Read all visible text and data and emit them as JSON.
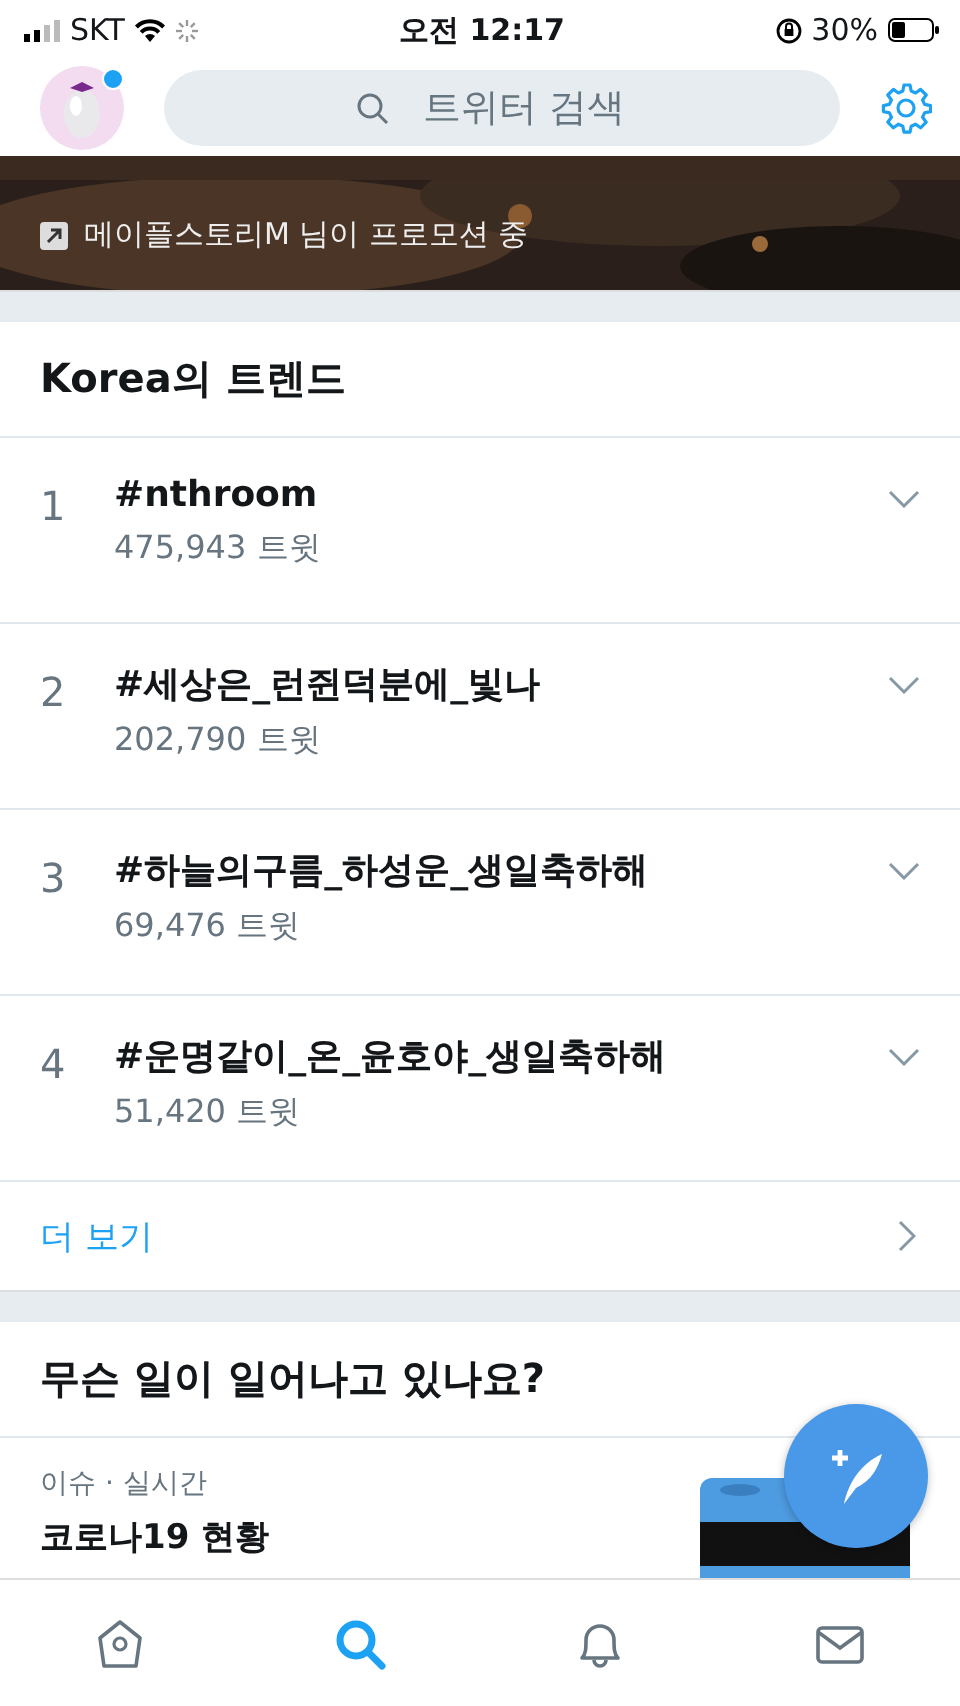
{
  "status_bar": {
    "carrier": "SKT",
    "time": "오전 12:17",
    "battery": "30%"
  },
  "header": {
    "search": {
      "placeholder": "트위터 검색"
    },
    "avatar_has_notification": true
  },
  "promo": {
    "kind": "picture",
    "sponsor": "메이플스토리M 님이 프로모션 중"
  },
  "trends": {
    "title": "Korea의 트렌드",
    "items": [
      {
        "rank": "1",
        "tag": "#nthroom",
        "count": "475,943 트윗"
      },
      {
        "rank": "2",
        "tag": "#세상은_런쥔덕분에_빛나",
        "count": "202,790 트윗"
      },
      {
        "rank": "3",
        "tag": "#하늘의구름_하성운_생일축하해",
        "count": "69,476 트윗"
      },
      {
        "rank": "4",
        "tag": "#운명같이_온_윤호야_생일축하해",
        "count": "51,420 트윗"
      }
    ],
    "more": "더 보기"
  },
  "happening": {
    "title": "무슨 일이 일어나고 있나요?",
    "items": [
      {
        "meta": "이슈 · 실시간",
        "headline": "코로나19 현황"
      }
    ]
  },
  "tab_bar": [
    {
      "kind": "home",
      "selected": false
    },
    {
      "kind": "search",
      "selected": true
    },
    {
      "kind": "notifications",
      "selected": false
    },
    {
      "kind": "messages",
      "selected": false
    }
  ]
}
